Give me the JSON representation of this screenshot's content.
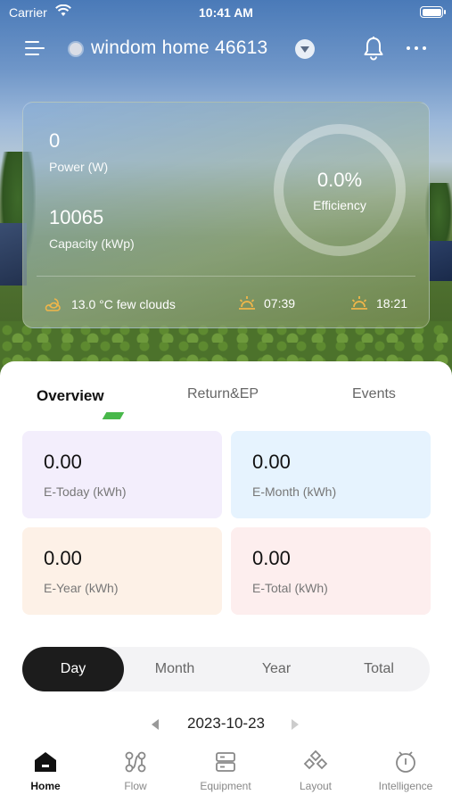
{
  "status_bar": {
    "carrier": "Carrier",
    "time": "10:41 AM"
  },
  "header": {
    "site_name": "windom home  46613"
  },
  "summary": {
    "power_value": "0",
    "power_label": "Power (W)",
    "capacity_value": "10065",
    "capacity_label": "Capacity (kWp)",
    "efficiency_value": "0.0%",
    "efficiency_label": "Efficiency",
    "weather": "13.0 °C few clouds",
    "sunrise": "07:39",
    "sunset": "18:21"
  },
  "tabs": [
    {
      "label": "Overview",
      "active": true
    },
    {
      "label": "Return&EP",
      "active": false
    },
    {
      "label": "Events",
      "active": false
    }
  ],
  "stats": [
    {
      "value": "0.00",
      "label": "E-Today (kWh)",
      "color": "#f3eefc"
    },
    {
      "value": "0.00",
      "label": "E-Month (kWh)",
      "color": "#e6f3fe"
    },
    {
      "value": "0.00",
      "label": "E-Year (kWh)",
      "color": "#fdf1e7"
    },
    {
      "value": "0.00",
      "label": "E-Total (kWh)",
      "color": "#fdeeee"
    }
  ],
  "period": {
    "options": [
      "Day",
      "Month",
      "Year",
      "Total"
    ],
    "selected": "Day"
  },
  "date": "2023-10-23",
  "bottom_nav": [
    {
      "label": "Home",
      "icon": "home-icon",
      "active": true
    },
    {
      "label": "Flow",
      "icon": "flow-icon",
      "active": false
    },
    {
      "label": "Equipment",
      "icon": "equipment-icon",
      "active": false
    },
    {
      "label": "Layout",
      "icon": "layout-icon",
      "active": false
    },
    {
      "label": "Intelligence",
      "icon": "intelligence-icon",
      "active": false
    }
  ],
  "colors": {
    "accent_green": "#48b84a",
    "active_dark": "#1c1c1c"
  }
}
